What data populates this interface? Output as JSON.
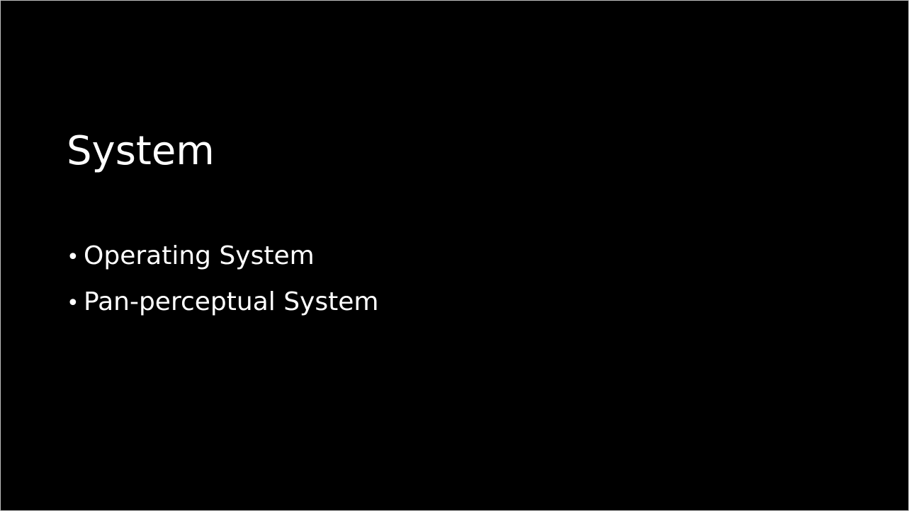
{
  "slide": {
    "title": "System",
    "bullet_glyph": "•",
    "bullets": [
      {
        "text": "Operating System"
      },
      {
        "text": "Pan-perceptual System"
      }
    ]
  },
  "colors": {
    "background": "#000000",
    "text": "#ffffff",
    "frame": "#bfbfbf"
  }
}
